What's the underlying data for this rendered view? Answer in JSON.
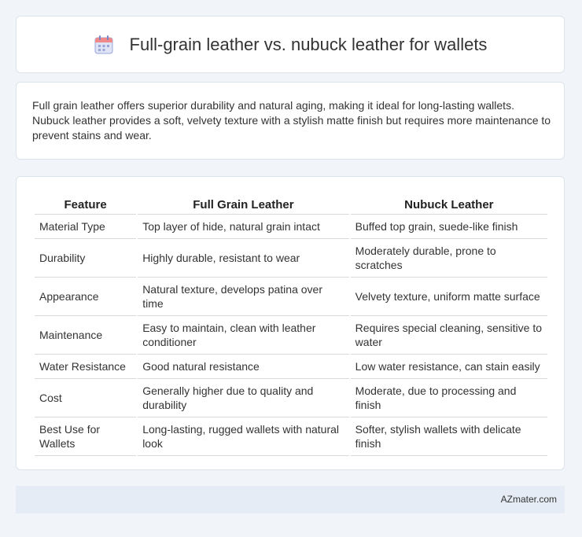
{
  "header": {
    "title": "Full-grain leather vs. nubuck leather for wallets",
    "icon": "calendar-icon"
  },
  "intro": {
    "text": "Full grain leather offers superior durability and natural aging, making it ideal for long-lasting wallets. Nubuck leather provides a soft, velvety texture with a stylish matte finish but requires more maintenance to prevent stains and wear."
  },
  "table": {
    "headers": [
      "Feature",
      "Full Grain Leather",
      "Nubuck Leather"
    ],
    "rows": [
      [
        "Material Type",
        "Top layer of hide, natural grain intact",
        "Buffed top grain, suede-like finish"
      ],
      [
        "Durability",
        "Highly durable, resistant to wear",
        "Moderately durable, prone to scratches"
      ],
      [
        "Appearance",
        "Natural texture, develops patina over time",
        "Velvety texture, uniform matte surface"
      ],
      [
        "Maintenance",
        "Easy to maintain, clean with leather conditioner",
        "Requires special cleaning, sensitive to water"
      ],
      [
        "Water Resistance",
        "Good natural resistance",
        "Low water resistance, can stain easily"
      ],
      [
        "Cost",
        "Generally higher due to quality and durability",
        "Moderate, due to processing and finish"
      ],
      [
        "Best Use for Wallets",
        "Long-lasting, rugged wallets with natural look",
        "Softer, stylish wallets with delicate finish"
      ]
    ]
  },
  "footer": {
    "brand": "AZmater.com"
  }
}
